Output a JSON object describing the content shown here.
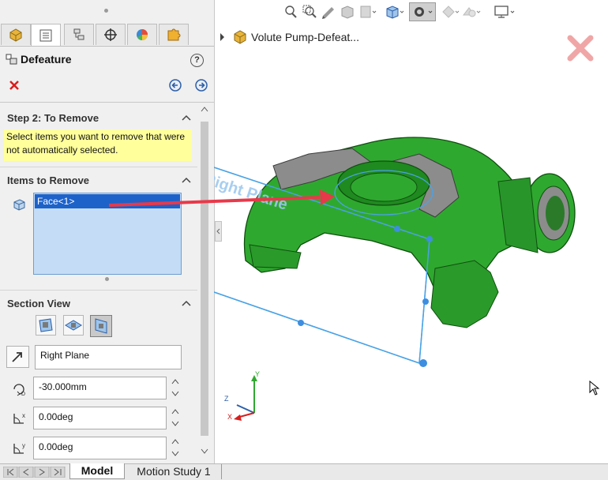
{
  "panel": {
    "title": "Defeature",
    "help_icon": "help-icon",
    "tabs": [
      {
        "icon": "feature-manager-icon"
      },
      {
        "icon": "property-manager-icon"
      },
      {
        "icon": "configuration-manager-icon"
      },
      {
        "icon": "dimxpert-icon"
      },
      {
        "icon": "display-manager-icon"
      },
      {
        "icon": "addin-icon"
      }
    ],
    "step": {
      "title": "Step 2: To Remove",
      "message": "Select items you want to remove that were not automatically selected."
    },
    "items": {
      "title": "Items to Remove",
      "list": [
        "Face<1>"
      ]
    },
    "section_view": {
      "title": "Section View",
      "plane": "Right Plane",
      "offset": "-30.000mm",
      "angle_x": "0.00deg",
      "angle_y": "0.00deg"
    }
  },
  "viewport": {
    "tree_root": "Volute Pump-Defeat...",
    "plane_label": "Right Plane",
    "triad": {
      "x": "X",
      "y": "Y",
      "z": "Z"
    },
    "colors": {
      "part": "#2fa82f",
      "section_face": "#8c8c8c",
      "plane": "#4aa3e6",
      "callout": "#e8394a"
    }
  },
  "bottom_tabs": [
    "Model",
    "Motion Study 1"
  ]
}
